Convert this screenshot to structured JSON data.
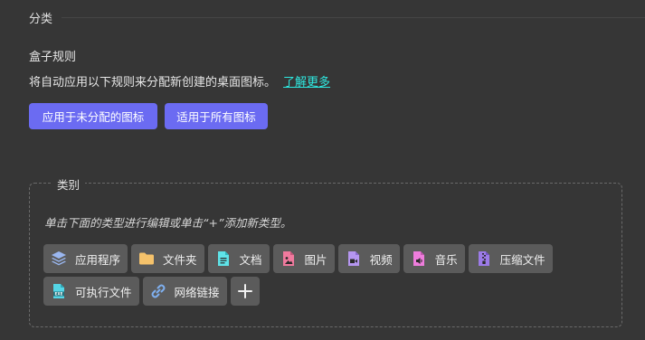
{
  "section": {
    "title": "分类"
  },
  "rules": {
    "title": "盒子规则",
    "description": "将自动应用以下规则来分配新创建的桌面图标。",
    "learn_more": "了解更多",
    "apply_unassigned_button": "应用于未分配的图标",
    "apply_all_button": "适用于所有图标"
  },
  "categories": {
    "legend": "类别",
    "hint": "单击下面的类型进行编辑或单击“+”添加新类型。",
    "items": [
      {
        "label": "应用程序",
        "icon": "layers-icon",
        "color": "#9ab7f0"
      },
      {
        "label": "文件夹",
        "icon": "folder-icon",
        "color": "#f5c26b"
      },
      {
        "label": "文档",
        "icon": "document-icon",
        "color": "#5fe3e8"
      },
      {
        "label": "图片",
        "icon": "image-file-icon",
        "color": "#f07a9e"
      },
      {
        "label": "视频",
        "icon": "video-file-icon",
        "color": "#b596f0"
      },
      {
        "label": "音乐",
        "icon": "music-file-icon",
        "color": "#ee7ddc"
      },
      {
        "label": "压缩文件",
        "icon": "archive-file-icon",
        "color": "#9c7be8"
      },
      {
        "label": "可执行文件",
        "icon": "exe-file-icon",
        "color": "#55d6e6"
      },
      {
        "label": "网络链接",
        "icon": "link-icon",
        "color": "#7fb0f0"
      }
    ],
    "add_icon": "plus-icon"
  }
}
